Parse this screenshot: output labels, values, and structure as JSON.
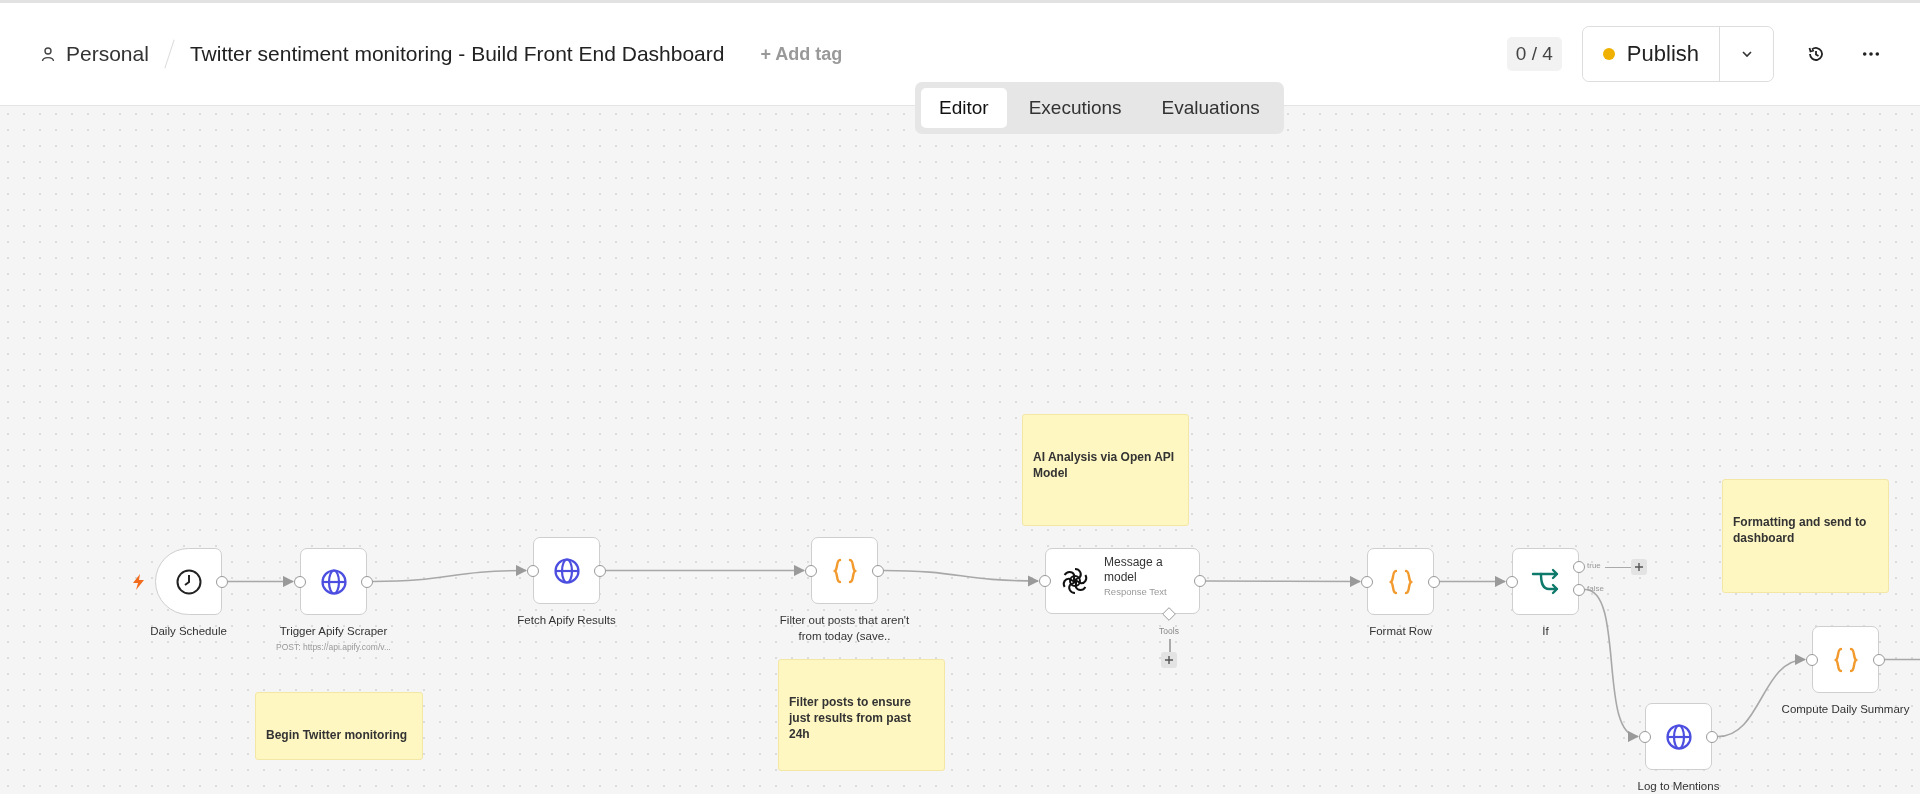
{
  "header": {
    "project": "Personal",
    "workflow": "Twitter sentiment monitoring - Build Front End Dashboard",
    "add_tag": "+ Add tag",
    "progress": "0 / 4",
    "publish": "Publish"
  },
  "tabs": [
    {
      "label": "Editor",
      "selected": true
    },
    {
      "label": "Executions",
      "selected": false
    },
    {
      "label": "Evaluations",
      "selected": false
    }
  ],
  "nodes": [
    {
      "kind": "trigger",
      "label": "Daily Schedule"
    },
    {
      "kind": "http",
      "label": "Trigger Apify Scraper",
      "subtitle": "POST: https://api.apify.com/v..."
    },
    {
      "kind": "http",
      "label": "Fetch Apify Results"
    },
    {
      "kind": "code",
      "label": "Filter out posts that aren't from today (save.."
    },
    {
      "kind": "ai",
      "label": "Message a model",
      "subtitle": "Response Text",
      "tools_label": "Tools"
    },
    {
      "kind": "code",
      "label": "Format Row"
    },
    {
      "kind": "if",
      "label": "If",
      "outputs": [
        "true",
        "false"
      ]
    },
    {
      "kind": "http",
      "label": "Log to Mentions"
    },
    {
      "kind": "code",
      "label": "Compute Daily Summary"
    }
  ],
  "sticky_notes": [
    {
      "text": "Begin Twitter monitoring"
    },
    {
      "text": "Filter posts to ensure just results from past 24h"
    },
    {
      "text": "AI Analysis via Open API Model"
    },
    {
      "text": "Formatting and send to dashboard"
    }
  ]
}
